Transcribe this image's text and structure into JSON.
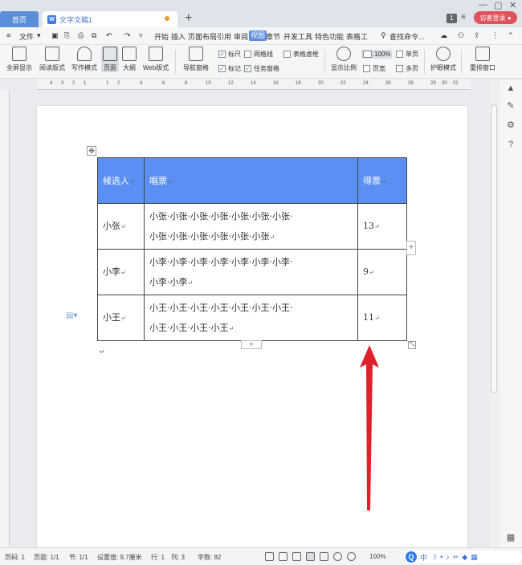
{
  "titlebar": {
    "home_tab": "首页",
    "doc_tab": "文字文稿1",
    "doc_icon": "W",
    "badge": "1",
    "visitor_login": "访客登录"
  },
  "menubar": {
    "file": "文件",
    "items": [
      "开始",
      "插入",
      "页面布局",
      "引用",
      "审阅",
      "视图",
      "章节",
      "开发工具",
      "特色功能",
      "表格工"
    ],
    "active": "视图",
    "search": "查找命令..."
  },
  "ribbon": {
    "buttons": [
      "全屏显示",
      "阅读版式",
      "写作模式",
      "页面",
      "大纲",
      "Web版式"
    ],
    "nav_pane": "导航窗格",
    "checks": [
      {
        "label": "标尺",
        "checked": true
      },
      {
        "label": "网格线",
        "checked": false
      },
      {
        "label": "表格虚框",
        "checked": false
      },
      {
        "label": "标记",
        "checked": true
      },
      {
        "label": "任务窗格",
        "checked": true
      }
    ],
    "zoom_ratio": "显示比例",
    "zoom_value": "100%",
    "single_page": "单页",
    "page_width": "页宽",
    "multi_page": "多页",
    "eye_mode": "护眼模式",
    "rearrange_window": "重排窗口"
  },
  "ruler": {
    "ticks": [
      "4",
      "3",
      "2",
      "1",
      "1",
      "2",
      "4",
      "6",
      "8",
      "10",
      "12",
      "14",
      "16",
      "18",
      "20",
      "22",
      "24",
      "26",
      "28",
      "29",
      "30",
      "31"
    ]
  },
  "table": {
    "headers": [
      "候选人",
      "唱票",
      "得票"
    ],
    "rows": [
      {
        "name": "小张",
        "votes_line1": "小张·小张·小张·小张·小张·小张·小张·",
        "votes_line2": "小张·小张·小张·小张·小张·小张",
        "count": "13"
      },
      {
        "name": "小李",
        "votes_line1": "小李·小李·小李·小李·小李·小李·小李·",
        "votes_line2": "小李·小李",
        "count": "9"
      },
      {
        "name": "小王",
        "votes_line1": "小王·小王·小王·小王·小王·小王·小王·",
        "votes_line2": "小王·小王·小王·小王",
        "count": "11"
      }
    ]
  },
  "statusbar": {
    "page_num": "页码: 1",
    "pages": "页面: 1/1",
    "section": "节: 1/1",
    "set_value": "设置值: 9.7厘米",
    "row": "行: 1",
    "col": "列: 3",
    "word_count": "字数: 82",
    "zoom": "100%"
  },
  "ime": {
    "lang": "中"
  },
  "colors": {
    "accent": "#5b8ed8",
    "table_header": "#5b8ff3",
    "visitor": "#e1525a",
    "arrow": "#e0202a"
  }
}
